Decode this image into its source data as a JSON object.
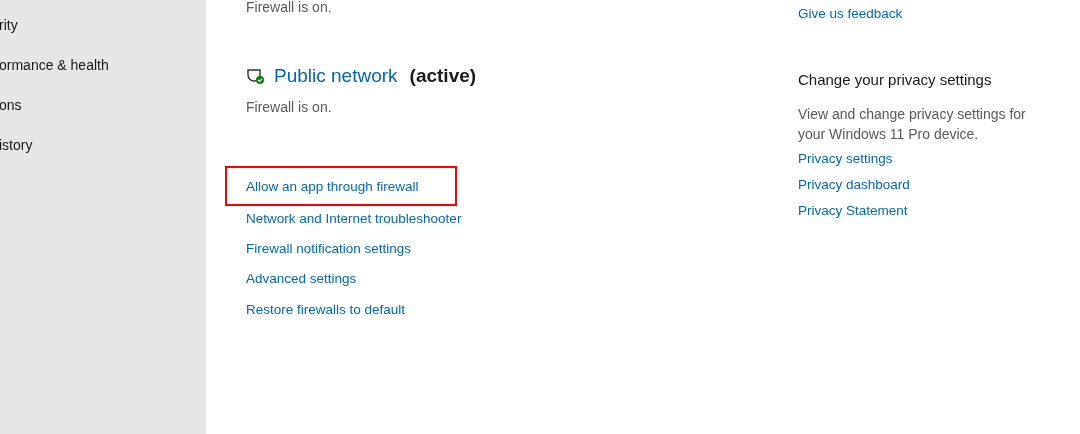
{
  "sidebar": {
    "items": [
      {
        "label": "rity"
      },
      {
        "label": "ormance & health"
      },
      {
        "label": "ons"
      },
      {
        "label": "istory"
      }
    ]
  },
  "main": {
    "previous_status": "Firewall is on.",
    "network": {
      "name": "Public network",
      "tag": "(active)",
      "status": "Firewall is on."
    },
    "links": [
      {
        "label": "Allow an app through firewall",
        "highlighted": true
      },
      {
        "label": "Network and Internet troubleshooter",
        "highlighted": false
      },
      {
        "label": "Firewall notification settings",
        "highlighted": false
      },
      {
        "label": "Advanced settings",
        "highlighted": false
      },
      {
        "label": "Restore firewalls to default",
        "highlighted": false
      }
    ]
  },
  "aside": {
    "feedback_link": "Give us feedback",
    "privacy": {
      "heading": "Change your privacy settings",
      "text": "View and change privacy settings for your Windows 11 Pro device.",
      "links": [
        "Privacy settings",
        "Privacy dashboard",
        "Privacy Statement"
      ]
    }
  }
}
